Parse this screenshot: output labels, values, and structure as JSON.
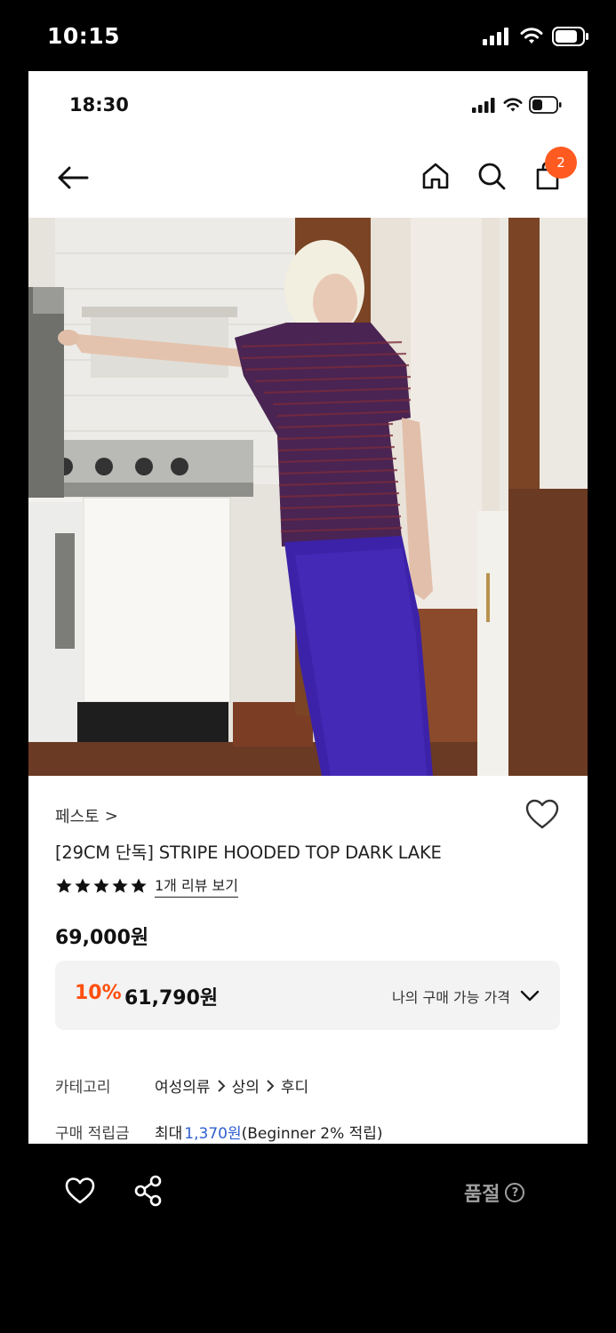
{
  "outer_status": {
    "time": "10:15"
  },
  "inner_status": {
    "time": "18:30"
  },
  "nav": {
    "cart_count": "2"
  },
  "product": {
    "brand": "페스토",
    "brand_chevron": ">",
    "title": "[29CM 단독] STRIPE HOODED TOP DARK LAKE",
    "rating_stars": 5,
    "review_link": "1개 리뷰 보기",
    "price": "69,000원",
    "discount_percent": "10%",
    "discount_price": "61,790원",
    "discount_label": "나의 구매 가능 가격"
  },
  "meta": {
    "category_label": "카테고리",
    "category_path": [
      "여성의류",
      "상의",
      "후디"
    ],
    "points_label": "구매 적립금",
    "points_prefix": "최대",
    "points_value": "1,370원",
    "points_suffix": "(Beginner 2% 적립)"
  },
  "bottom_bar": {
    "soldout_label": "품절",
    "help_glyph": "?"
  },
  "colors": {
    "accent_orange": "#ff4f0f",
    "badge": "#ff5a1f",
    "link_blue": "#2f5fd0",
    "soldout_gray": "#a0a0a0"
  }
}
